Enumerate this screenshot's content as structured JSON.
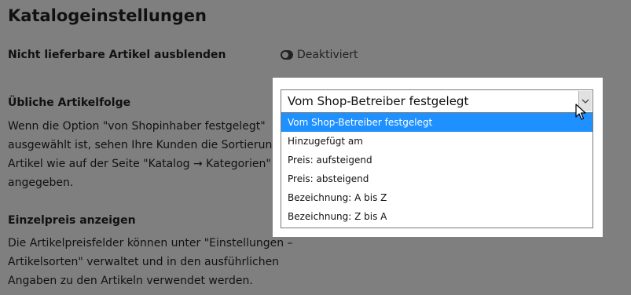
{
  "page": {
    "title": "Katalogeinstellungen"
  },
  "hide_unavailable": {
    "label": "Nicht lieferbare Artikel ausblenden",
    "status": "Deaktiviert"
  },
  "sort_order": {
    "label": "Übliche Artikelfolge",
    "description_lines": [
      "Wenn die Option \"von Shopinhaber festgelegt\"",
      "ausgewählt ist, sehen Ihre Kunden die Sortierung der",
      "Artikel wie auf der Seite \"Katalog → Kategorien\"",
      "angegeben."
    ],
    "selected_value": "Vom Shop-Betreiber festgelegt",
    "options": [
      "Vom Shop-Betreiber festgelegt",
      "Hinzugefügt am",
      "Preis: aufsteigend",
      "Preis: absteigend",
      "Bezeichnung: A bis Z",
      "Bezeichnung: Z bis A"
    ],
    "highlighted_index": 0
  },
  "unit_price": {
    "label": "Einzelpreis anzeigen",
    "description_lines": [
      "Die Artikelpreisfelder können unter \"Einstellungen –",
      "Artikelsorten\" verwaltet und in den ausführlichen",
      "Angaben zu den Artikeln verwendet werden."
    ]
  },
  "icons": {
    "toggle": "toggle-off-icon",
    "dropdown_arrow": "chevron-down-icon",
    "cursor": "mouse-pointer-icon"
  }
}
